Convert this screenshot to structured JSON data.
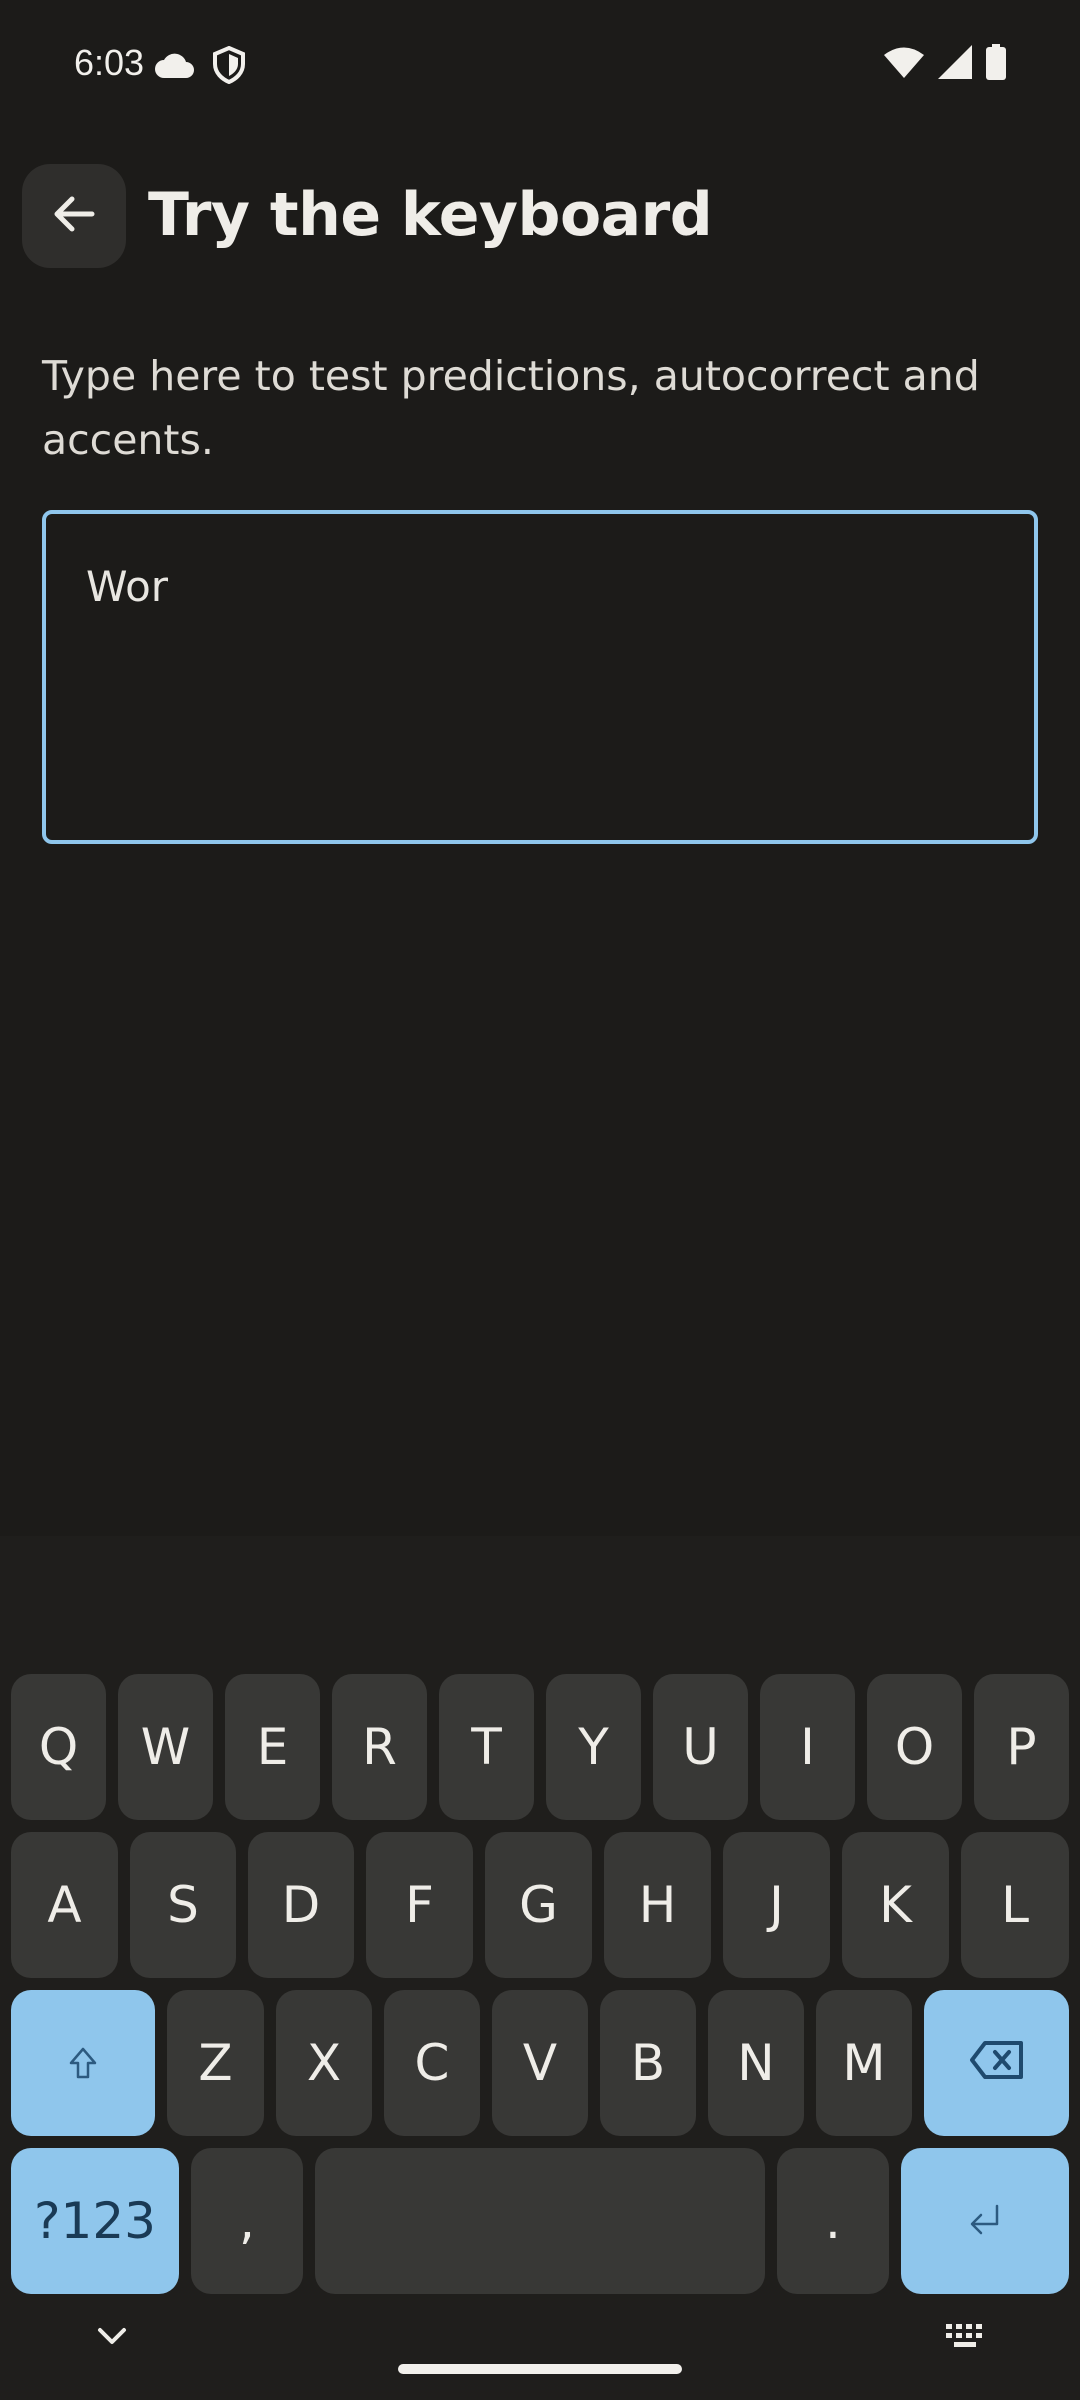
{
  "status_bar": {
    "time": "6:03",
    "icons_left": [
      "cloud-icon",
      "shield-icon"
    ],
    "icons_right": [
      "wifi-icon",
      "signal-icon",
      "battery-icon"
    ]
  },
  "app_bar": {
    "back_icon": "arrow-left-icon",
    "title": "Try the keyboard"
  },
  "instructions": "Type here to test predictions, autocorrect and accents.",
  "text_input": {
    "value": "Wor"
  },
  "keyboard": {
    "row1": [
      "Q",
      "W",
      "E",
      "R",
      "T",
      "Y",
      "U",
      "I",
      "O",
      "P"
    ],
    "row2": [
      "A",
      "S",
      "D",
      "F",
      "G",
      "H",
      "J",
      "K",
      "L"
    ],
    "row3": [
      "Z",
      "X",
      "C",
      "V",
      "B",
      "N",
      "M"
    ],
    "shift_icon": "shift-icon",
    "backspace_icon": "backspace-icon",
    "symbols_label": "?123",
    "comma_label": ",",
    "period_label": ".",
    "enter_icon": "enter-icon",
    "hide_icon": "chevron-down-icon",
    "switch_icon": "keyboard-icon"
  },
  "colors": {
    "background": "#1c1b19",
    "key": "#383836",
    "accent_key": "#8fc6ec",
    "input_border": "#8fc6ec"
  }
}
